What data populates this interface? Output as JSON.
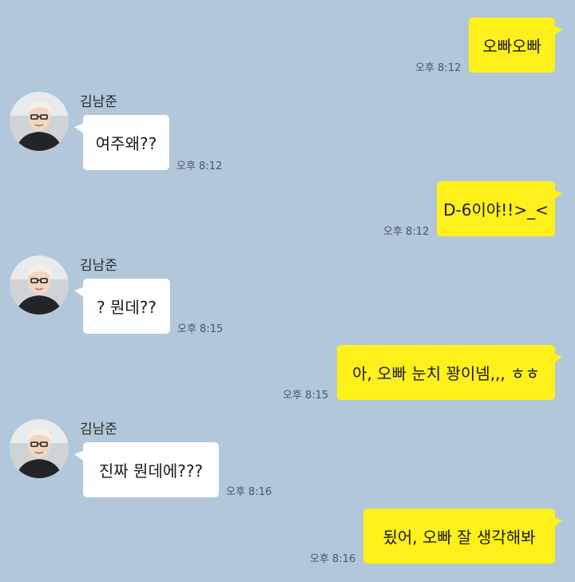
{
  "colors": {
    "background": "#b2c7d9",
    "outgoing_bubble": "#fef01b",
    "incoming_bubble": "#ffffff"
  },
  "messages": [
    {
      "direction": "out",
      "text": "오빠오빠",
      "time": "오후 8:12"
    },
    {
      "direction": "in",
      "sender": "김남준",
      "avatar_icon": "profile-photo",
      "text": "여주왜??",
      "time": "오후 8:12"
    },
    {
      "direction": "out",
      "text": "D-6이야!!>_<",
      "time": "오후 8:12"
    },
    {
      "direction": "in",
      "sender": "김남준",
      "avatar_icon": "profile-photo",
      "text": "? 뭔데??",
      "time": "오후 8:15"
    },
    {
      "direction": "out",
      "text": "아, 오빠 눈치 꽝이넴,,, ㅎㅎ",
      "time": "오후 8:15"
    },
    {
      "direction": "in",
      "sender": "김남준",
      "avatar_icon": "profile-photo",
      "text": "진짜 뭔데에???",
      "time": "오후 8:16"
    },
    {
      "direction": "out",
      "text": "됬어, 오빠 잘 생각해봐",
      "time": "오후 8:16"
    }
  ]
}
